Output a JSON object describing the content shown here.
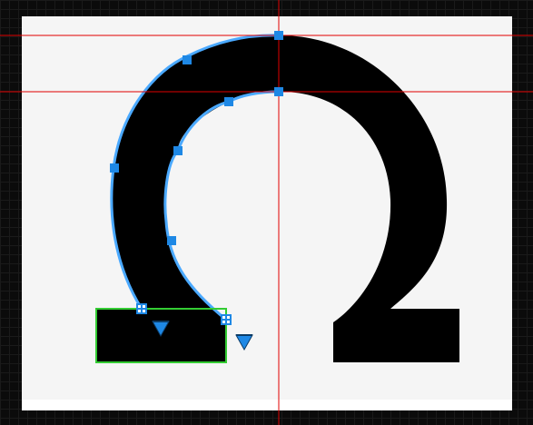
{
  "canvas": {
    "background_color": "#0b0b0b",
    "artboard_color": "#f5f5f5",
    "glyph_color": "#000000",
    "guide_color": "#e10000",
    "selection_color": "#4aa9ff",
    "point_color": "#1e88e5",
    "box_color": "#33cc33"
  },
  "glyph": {
    "character": "Ω"
  },
  "icons": {
    "corner_marker": "plus-square-icon",
    "direction_marker": "triangle-down-icon"
  }
}
